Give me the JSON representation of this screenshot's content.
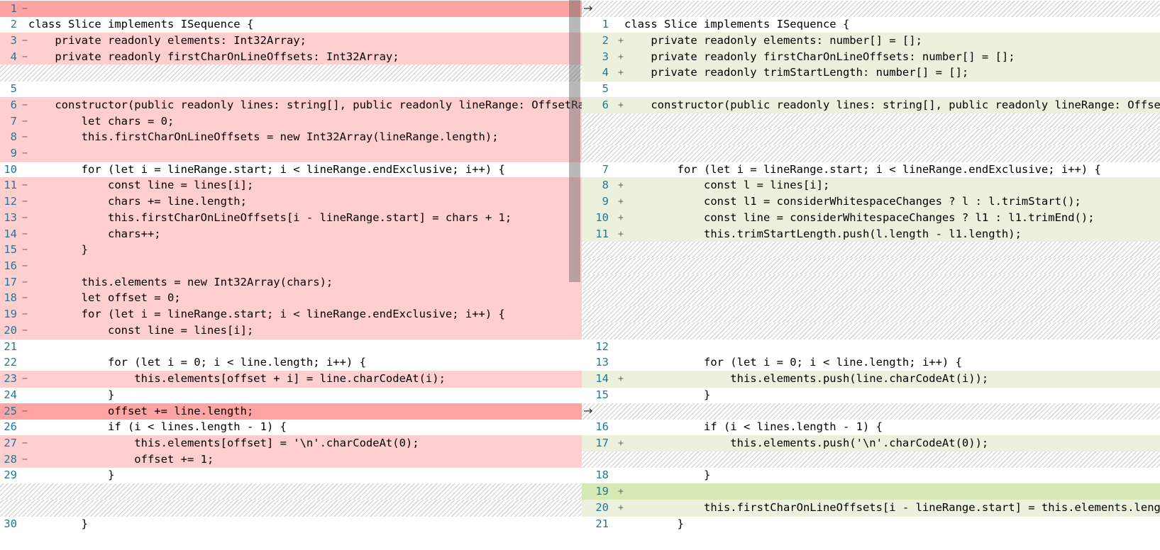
{
  "left": {
    "lines": [
      {
        "n": "1",
        "m": "−",
        "bg": "del-strong",
        "c": ""
      },
      {
        "n": "2",
        "m": "",
        "bg": "",
        "c": "class Slice implements ISequence {"
      },
      {
        "n": "3",
        "m": "−",
        "bg": "del",
        "c": "    private readonly elements: Int32Array;"
      },
      {
        "n": "4",
        "m": "−",
        "bg": "del",
        "c": "    private readonly firstCharOnLineOffsets: Int32Array;"
      },
      {
        "n": "",
        "m": "",
        "bg": "hatch",
        "c": ""
      },
      {
        "n": "5",
        "m": "",
        "bg": "",
        "c": ""
      },
      {
        "n": "6",
        "m": "−",
        "bg": "del",
        "c": "    constructor(public readonly lines: string[], public readonly lineRange: OffsetRange, public readonly considerWhitespaceChanges: boolean) {"
      },
      {
        "n": "7",
        "m": "−",
        "bg": "del",
        "c": "        let chars = 0;"
      },
      {
        "n": "8",
        "m": "−",
        "bg": "del",
        "c": "        this.firstCharOnLineOffsets = new Int32Array(lineRange.length);"
      },
      {
        "n": "9",
        "m": "−",
        "bg": "del",
        "c": ""
      },
      {
        "n": "10",
        "m": "",
        "bg": "",
        "c": "        for (let i = lineRange.start; i < lineRange.endExclusive; i++) {"
      },
      {
        "n": "11",
        "m": "−",
        "bg": "del",
        "c": "            const line = lines[i];"
      },
      {
        "n": "12",
        "m": "−",
        "bg": "del",
        "c": "            chars += line.length;"
      },
      {
        "n": "13",
        "m": "−",
        "bg": "del",
        "c": "            this.firstCharOnLineOffsets[i - lineRange.start] = chars + 1;"
      },
      {
        "n": "14",
        "m": "−",
        "bg": "del",
        "c": "            chars++;"
      },
      {
        "n": "15",
        "m": "−",
        "bg": "del",
        "c": "        }"
      },
      {
        "n": "16",
        "m": "−",
        "bg": "del",
        "c": ""
      },
      {
        "n": "17",
        "m": "−",
        "bg": "del",
        "c": "        this.elements = new Int32Array(chars);"
      },
      {
        "n": "18",
        "m": "−",
        "bg": "del",
        "c": "        let offset = 0;"
      },
      {
        "n": "19",
        "m": "−",
        "bg": "del",
        "c": "        for (let i = lineRange.start; i < lineRange.endExclusive; i++) {"
      },
      {
        "n": "20",
        "m": "−",
        "bg": "del",
        "c": "            const line = lines[i];"
      },
      {
        "n": "21",
        "m": "",
        "bg": "",
        "c": ""
      },
      {
        "n": "22",
        "m": "",
        "bg": "",
        "c": "            for (let i = 0; i < line.length; i++) {"
      },
      {
        "n": "23",
        "m": "−",
        "bg": "del",
        "c": "                this.elements[offset + i] = line.charCodeAt(i);"
      },
      {
        "n": "24",
        "m": "",
        "bg": "",
        "c": "            }"
      },
      {
        "n": "25",
        "m": "−",
        "bg": "del-strong",
        "c": "            offset += line.length;"
      },
      {
        "n": "26",
        "m": "",
        "bg": "",
        "c": "            if (i < lines.length - 1) {"
      },
      {
        "n": "27",
        "m": "−",
        "bg": "del",
        "c": "                this.elements[offset] = '\\n'.charCodeAt(0);"
      },
      {
        "n": "28",
        "m": "−",
        "bg": "del",
        "c": "                offset += 1;"
      },
      {
        "n": "29",
        "m": "",
        "bg": "",
        "c": "            }"
      },
      {
        "n": "",
        "m": "",
        "bg": "hatch",
        "c": ""
      },
      {
        "n": "",
        "m": "",
        "bg": "hatch",
        "c": ""
      },
      {
        "n": "30",
        "m": "",
        "bg": "",
        "c": "        }"
      }
    ]
  },
  "right": {
    "lines": [
      {
        "n": "",
        "m": "",
        "bg": "hatch",
        "c": ""
      },
      {
        "n": "1",
        "m": "",
        "bg": "",
        "c": "class Slice implements ISequence {"
      },
      {
        "n": "2",
        "m": "+",
        "bg": "ins",
        "c": "    private readonly elements: number[] = [];"
      },
      {
        "n": "3",
        "m": "+",
        "bg": "ins",
        "c": "    private readonly firstCharOnLineOffsets: number[] = [];"
      },
      {
        "n": "4",
        "m": "+",
        "bg": "ins",
        "c": "    private readonly trimStartLength: number[] = [];"
      },
      {
        "n": "5",
        "m": "",
        "bg": "",
        "c": ""
      },
      {
        "n": "6",
        "m": "+",
        "bg": "ins",
        "c": "    constructor(public readonly lines: string[], public readonly lineRange: OffsetRange, public readonly considerWhitespaceChanges: boolean) {"
      },
      {
        "n": "",
        "m": "",
        "bg": "hatch",
        "c": ""
      },
      {
        "n": "",
        "m": "",
        "bg": "hatch",
        "c": ""
      },
      {
        "n": "",
        "m": "",
        "bg": "hatch",
        "c": ""
      },
      {
        "n": "7",
        "m": "",
        "bg": "",
        "c": "        for (let i = lineRange.start; i < lineRange.endExclusive; i++) {"
      },
      {
        "n": "8",
        "m": "+",
        "bg": "ins",
        "c": "            const l = lines[i];"
      },
      {
        "n": "9",
        "m": "+",
        "bg": "ins",
        "c": "            const l1 = considerWhitespaceChanges ? l : l.trimStart();"
      },
      {
        "n": "10",
        "m": "+",
        "bg": "ins",
        "c": "            const line = considerWhitespaceChanges ? l1 : l1.trimEnd();"
      },
      {
        "n": "11",
        "m": "+",
        "bg": "ins",
        "c": "            this.trimStartLength.push(l.length - l1.length);"
      },
      {
        "n": "",
        "m": "",
        "bg": "hatch",
        "c": ""
      },
      {
        "n": "",
        "m": "",
        "bg": "hatch",
        "c": ""
      },
      {
        "n": "",
        "m": "",
        "bg": "hatch",
        "c": ""
      },
      {
        "n": "",
        "m": "",
        "bg": "hatch",
        "c": ""
      },
      {
        "n": "",
        "m": "",
        "bg": "hatch",
        "c": ""
      },
      {
        "n": "",
        "m": "",
        "bg": "hatch",
        "c": ""
      },
      {
        "n": "12",
        "m": "",
        "bg": "",
        "c": ""
      },
      {
        "n": "13",
        "m": "",
        "bg": "",
        "c": "            for (let i = 0; i < line.length; i++) {"
      },
      {
        "n": "14",
        "m": "+",
        "bg": "ins",
        "c": "                this.elements.push(line.charCodeAt(i));"
      },
      {
        "n": "15",
        "m": "",
        "bg": "",
        "c": "            }"
      },
      {
        "n": "",
        "m": "",
        "bg": "hatch",
        "c": ""
      },
      {
        "n": "16",
        "m": "",
        "bg": "",
        "c": "            if (i < lines.length - 1) {"
      },
      {
        "n": "17",
        "m": "+",
        "bg": "ins",
        "c": "                this.elements.push('\\n'.charCodeAt(0));"
      },
      {
        "n": "",
        "m": "",
        "bg": "hatch",
        "c": ""
      },
      {
        "n": "18",
        "m": "",
        "bg": "",
        "c": "            }"
      },
      {
        "n": "19",
        "m": "+",
        "bg": "ins-strong",
        "c": ""
      },
      {
        "n": "20",
        "m": "+",
        "bg": "ins",
        "c": "            this.firstCharOnLineOffsets[i - lineRange.start] = this.elements.length;"
      },
      {
        "n": "21",
        "m": "",
        "bg": "",
        "c": "        }"
      }
    ]
  },
  "arrows": [
    "→",
    "→"
  ],
  "colors": {
    "deleted_line": "#ffcfcf",
    "deleted_char": "#ffa3a3",
    "inserted_line": "#ebf1dd",
    "inserted_char": "#d4e8b0",
    "line_number": "#237893"
  }
}
